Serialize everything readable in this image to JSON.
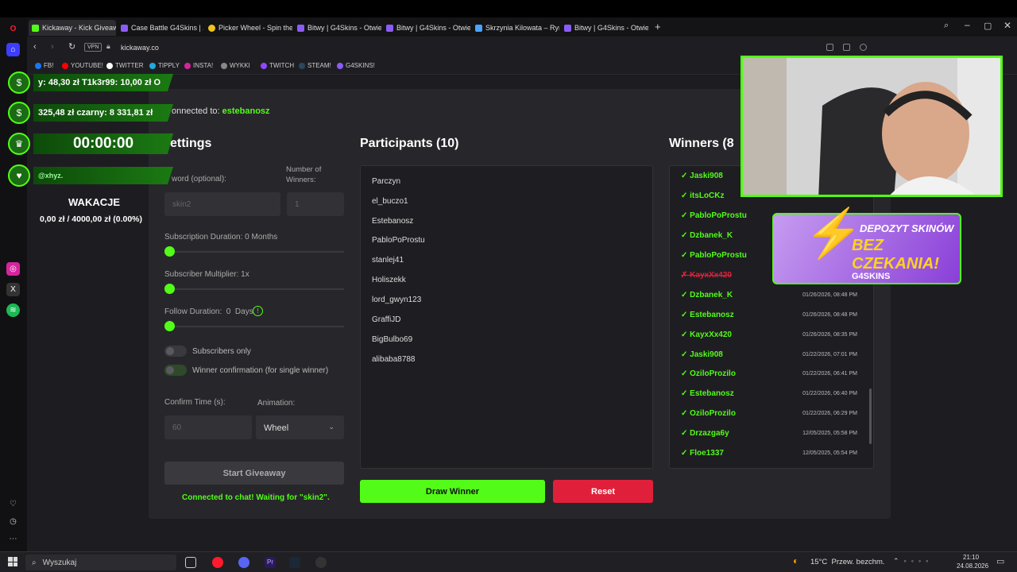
{
  "browser": {
    "tabs": [
      {
        "label": "Kickaway - Kick Giveaway",
        "active": true,
        "color": "#53fc18"
      },
      {
        "label": "Case Battle G4Skins | Zdoł",
        "color": "#8a5cf6"
      },
      {
        "label": "Picker Wheel - Spin the W",
        "color": "#f0c419"
      },
      {
        "label": "Bitwy | G4Skins - Otwieraj",
        "color": "#8a5cf6"
      },
      {
        "label": "Bitwy | G4Skins - Otwieraj",
        "color": "#8a5cf6"
      },
      {
        "label": "Skrzynia Kilowata – Rynek",
        "color": "#4aa3ff"
      },
      {
        "label": "Bitwy | G4Skins - Otwieraj",
        "color": "#8a5cf6"
      }
    ],
    "vpn_label": "VPN",
    "url": "kickaway.co",
    "bookmarks": [
      "FB!",
      "YOUTUBE!",
      "TWITTER",
      "TIPPLY",
      "INSTA!",
      "WYKKI",
      "TWITCH",
      "STEAM!",
      "G4SKINS!"
    ]
  },
  "overlay": {
    "row1": "y: 48,30 zł T1k3r99: 10,00 zł O",
    "row2": "325,48 zł czarny: 8 331,81 zł",
    "timer": "00:00:00",
    "handle": "@xhyz.",
    "goal_title": "WAKACJE",
    "goal_progress": "0,00 zł / 4000,00 zł (0.00%)"
  },
  "connection": {
    "prefix": "onnected to:",
    "channel": "estebanosz"
  },
  "settings": {
    "title": "ettings",
    "keyword_label": "word (optional):",
    "keyword_value": "skin2",
    "winners_label": "Number of Winners:",
    "winners_value": "1",
    "sub_duration_label": "Subscription Duration: 0 Months",
    "sub_multiplier_label": "Subscriber Multiplier: 1x",
    "follow_label": "Follow Duration:  0  Days",
    "subs_only_label": "Subscribers only",
    "winner_confirm_label": "Winner confirmation (for single winner)",
    "confirm_time_label": "Confirm Time (s):",
    "confirm_time_value": "60",
    "animation_label": "Animation:",
    "animation_value": "Wheel",
    "start_button": "Start Giveaway",
    "status": "Connected to chat! Waiting for \"skin2\"."
  },
  "participants": {
    "title": "Participants (10)",
    "items": [
      "Parczyn",
      "el_buczo1",
      "Estebanosz",
      "PabloPoProstu",
      "stanlej41",
      "Holiszekk",
      "lord_gwyn123",
      "GraffiJD",
      "BigBulbo69",
      "alibaba8788"
    ]
  },
  "actions": {
    "draw": "Draw Winner",
    "reset": "Reset"
  },
  "winners": {
    "title": "Winners (8",
    "items": [
      {
        "name": "✓ Jaski908",
        "date": "",
        "lost": false
      },
      {
        "name": "✓ itsLoCKz",
        "date": "",
        "lost": false
      },
      {
        "name": "✓ PabloPoProstu",
        "date": "",
        "lost": false
      },
      {
        "name": "✓ Dzbanek_K",
        "date": "",
        "lost": false
      },
      {
        "name": "✓ PabloPoProstu",
        "date": "",
        "lost": false
      },
      {
        "name": "✗ KayxXx420",
        "date": "",
        "lost": true
      },
      {
        "name": "✓ Dzbanek_K",
        "date": "01/26/2026, 08:48 PM",
        "lost": false
      },
      {
        "name": "✓ Estebanosz",
        "date": "01/26/2026, 08:48 PM",
        "lost": false
      },
      {
        "name": "✓ KayxXx420",
        "date": "01/26/2026, 08:35 PM",
        "lost": false
      },
      {
        "name": "✓ Jaski908",
        "date": "01/22/2026, 07:01 PM",
        "lost": false
      },
      {
        "name": "✓ OziloProzilo",
        "date": "01/22/2026, 06:41 PM",
        "lost": false
      },
      {
        "name": "✓ Estebanosz",
        "date": "01/22/2026, 06:40 PM",
        "lost": false
      },
      {
        "name": "✓ OziloProzilo",
        "date": "01/22/2026, 06:29 PM",
        "lost": false
      },
      {
        "name": "✓ Drzazga6y",
        "date": "12/05/2025, 05:58 PM",
        "lost": false
      },
      {
        "name": "✓ Floe1337",
        "date": "12/05/2025, 05:54 PM",
        "lost": false
      }
    ]
  },
  "ad": {
    "line1": "DEPOZYT SKINÓW",
    "line2": "BEZ CZEKANIA!",
    "brand": "G4SKINS"
  },
  "taskbar": {
    "search_placeholder": "Wyszukaj",
    "weather": "15°C  Przew. bezchm.",
    "time": "21:10",
    "date": "24.08.2026"
  },
  "colors": {
    "kick_green": "#53fc18",
    "reset_red": "#e0203a"
  }
}
